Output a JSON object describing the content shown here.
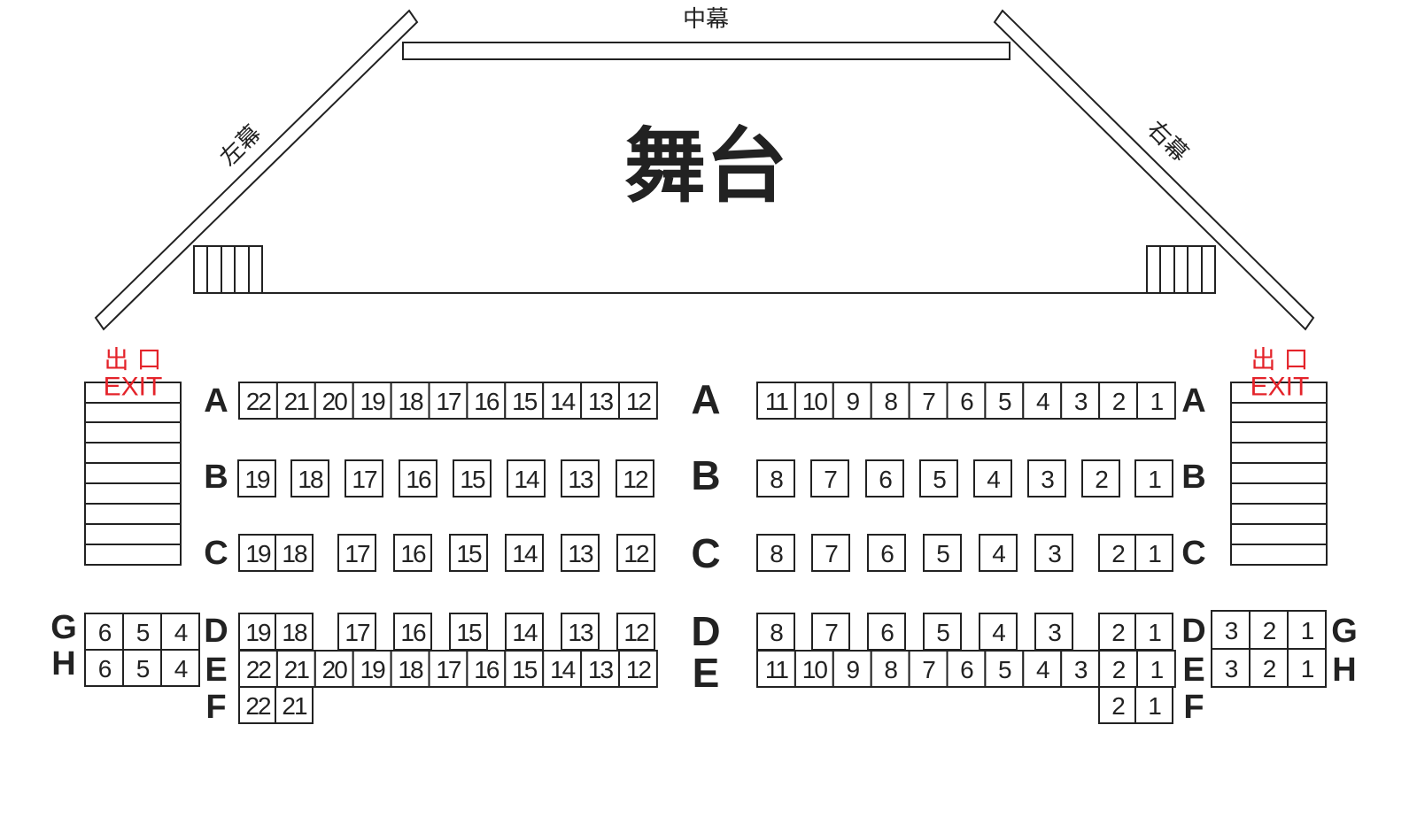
{
  "curtains": {
    "center": "中幕",
    "left": "左幕",
    "right": "右幕"
  },
  "stage": {
    "label": "舞台"
  },
  "exits": {
    "left": {
      "cn": "出 口",
      "en": "EXIT"
    },
    "right": {
      "cn": "出 口",
      "en": "EXIT"
    }
  },
  "row_labels": {
    "left_block": [
      "A",
      "B",
      "C",
      "D",
      "E",
      "F"
    ],
    "center_aisle": [
      "A",
      "B",
      "C",
      "D",
      "E"
    ],
    "right_block": [
      "A",
      "B",
      "C",
      "D",
      "E",
      "F"
    ],
    "left_side": [
      "G",
      "H"
    ],
    "right_side": [
      "G",
      "H"
    ]
  },
  "seats": {
    "left_A": [
      "22",
      "21",
      "20",
      "19",
      "18",
      "17",
      "16",
      "15",
      "14",
      "13",
      "12"
    ],
    "left_B": [
      "19",
      "18",
      "17",
      "16",
      "15",
      "14",
      "13",
      "12"
    ],
    "left_C": [
      "19",
      "18",
      "17",
      "16",
      "15",
      "14",
      "13",
      "12"
    ],
    "left_D": [
      "19",
      "18",
      "17",
      "16",
      "15",
      "14",
      "13",
      "12"
    ],
    "left_E": [
      "22",
      "21",
      "20",
      "19",
      "18",
      "17",
      "16",
      "15",
      "14",
      "13",
      "12"
    ],
    "left_F": [
      "22",
      "21"
    ],
    "right_A": [
      "11",
      "10",
      "9",
      "8",
      "7",
      "6",
      "5",
      "4",
      "3",
      "2",
      "1"
    ],
    "right_B": [
      "8",
      "7",
      "6",
      "5",
      "4",
      "3",
      "2",
      "1"
    ],
    "right_C": [
      "8",
      "7",
      "6",
      "5",
      "4",
      "3",
      "2",
      "1"
    ],
    "right_D": [
      "8",
      "7",
      "6",
      "5",
      "4",
      "3",
      "2",
      "1"
    ],
    "right_E": [
      "11",
      "10",
      "9",
      "8",
      "7",
      "6",
      "5",
      "4",
      "3",
      "2",
      "1"
    ],
    "right_F": [
      "2",
      "1"
    ],
    "side_G_left": [
      "6",
      "5",
      "4"
    ],
    "side_H_left": [
      "6",
      "5",
      "4"
    ],
    "side_G_right": [
      "3",
      "2",
      "1"
    ],
    "side_H_right": [
      "3",
      "2",
      "1"
    ]
  }
}
